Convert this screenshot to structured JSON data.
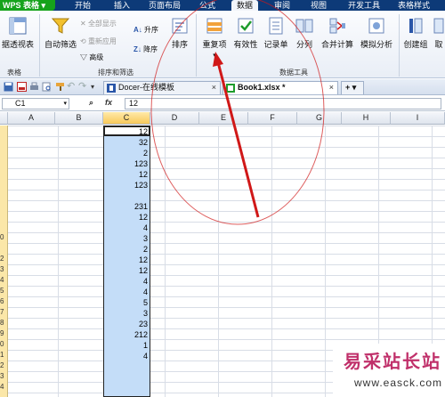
{
  "app": {
    "wps_button": "WPS 表格",
    "ribbon_tabs": [
      "开始",
      "插入",
      "页面布局",
      "公式",
      "数据",
      "审阅",
      "视图",
      "开发工具",
      "表格样式"
    ],
    "active_tab": "数据"
  },
  "ribbon": {
    "filter_view": "据透视表",
    "auto_filter": "自动筛选",
    "show_all": "全部显示",
    "reapply": "重新应用",
    "advanced": "高级",
    "sort_asc": "升序",
    "sort_desc": "降序",
    "sort": "排序",
    "duplicates": "重复项",
    "validation": "有效性",
    "record_form": "记录单",
    "split": "分列",
    "consolidate": "合并计算",
    "what_if": "模拟分析",
    "create_group": "创建组",
    "ungroup": "取",
    "group_table": "表格",
    "group_sort_filter": "排序和筛选",
    "group_data_tools": "数据工具"
  },
  "doc_tabs": [
    {
      "label": "Docer-在线模板",
      "close": "×"
    },
    {
      "label": "Book1.xlsx *",
      "close": "×"
    }
  ],
  "new_tab": "+",
  "formula_bar": {
    "name_box": "C1",
    "fx": "fx",
    "value": "12"
  },
  "columns": [
    "A",
    "B",
    "C",
    "D",
    "E",
    "F",
    "G",
    "H",
    "I"
  ],
  "selected_column": "C",
  "row_numbers": [
    "",
    "",
    "",
    "",
    "",
    "",
    "",
    "",
    "",
    "",
    "0",
    "",
    "2",
    "3",
    "4",
    "5",
    "6",
    "7",
    "8",
    "9",
    "0",
    "1",
    "2",
    "3",
    "4"
  ],
  "column_c_values": [
    "12",
    "32",
    "2",
    "123",
    "12",
    "123",
    "",
    "231",
    "12",
    "4",
    "3",
    "2",
    "12",
    "12",
    "4",
    "4",
    "5",
    "3",
    "23",
    "212",
    "1",
    "4"
  ],
  "watermark": {
    "main": "易采站长站",
    "sub": "www.easck.com"
  },
  "colors": {
    "annotation_red": "#d01818",
    "selection_fill": "#c4ddf8",
    "brand_green": "#16a31b",
    "title_blue": "#0d3a78"
  }
}
